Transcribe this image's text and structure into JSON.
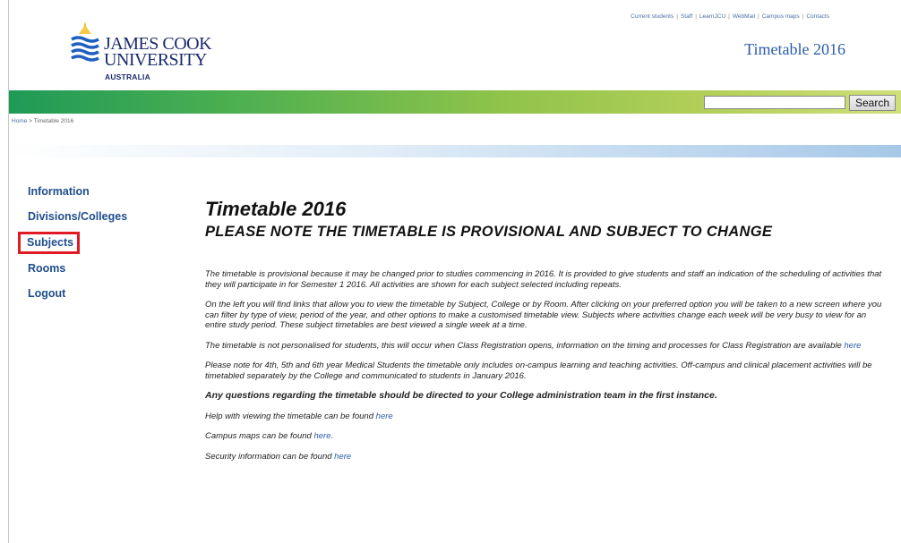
{
  "header": {
    "logo": {
      "name_line1": "JAMES COOK",
      "name_line2": "UNIVERSITY",
      "country": "AUSTRALIA"
    },
    "top_links": [
      "Current students",
      "Staff",
      "LearnJCU",
      "WebMail",
      "Campus maps",
      "Contacts"
    ],
    "site_title": "Timetable 2016",
    "search": {
      "placeholder": "",
      "value": "",
      "button_label": "Search"
    }
  },
  "breadcrumb": {
    "home": "Home",
    "separator": ">",
    "current": "Timetable 2016"
  },
  "sidebar": {
    "items": [
      {
        "label": "Information",
        "selected": false
      },
      {
        "label": "Divisions/Colleges",
        "selected": false
      },
      {
        "label": "Subjects",
        "selected": true
      },
      {
        "label": "Rooms",
        "selected": false
      },
      {
        "label": "Logout",
        "selected": false
      }
    ]
  },
  "main": {
    "title": "Timetable 2016",
    "subtitle": "PLEASE NOTE THE TIMETABLE IS PROVISIONAL AND SUBJECT TO CHANGE",
    "p1": "The timetable is provisional because it may be changed prior to studies commencing in 2016. It is provided to give students and staff an indication of the scheduling of activities that they will participate in for Semester 1 2016. All activities are shown for each subject selected including repeats.",
    "p2": "On the left you will find links that allow you to view the timetable by Subject, College or by Room. After clicking on your preferred option you will be taken to a new screen where you can filter by type of view, period of the year, and other options to make a customised timetable view. Subjects where activities change each week will be very busy to view for an entire study period. These subject timetables are best viewed a single week at a time.",
    "p3": "The timetable is not personalised for students, this will occur when Class Registration opens, information on the timing and processes for Class Registration are available",
    "p3_link": "here",
    "p4": "Please note for 4th, 5th and 6th year Medical Students the timetable only includes on-campus learning and teaching activities. Off-campus and clinical placement activities will be timetabled separately by the College and communicated to students in January 2016.",
    "p5": "Any questions regarding the timetable should be directed to your College administration team in the first instance.",
    "p6": "Help with viewing the timetable can be found",
    "p6_link": "here",
    "p7": "Campus maps can be found",
    "p7_link": "here.",
    "p8": "Security information can be found",
    "p8_link": "here"
  },
  "colors": {
    "accent_green": "#4caf50",
    "link_blue": "#2a5caa",
    "nav_blue": "#1f4e8c",
    "highlight_red": "#e01b24"
  }
}
